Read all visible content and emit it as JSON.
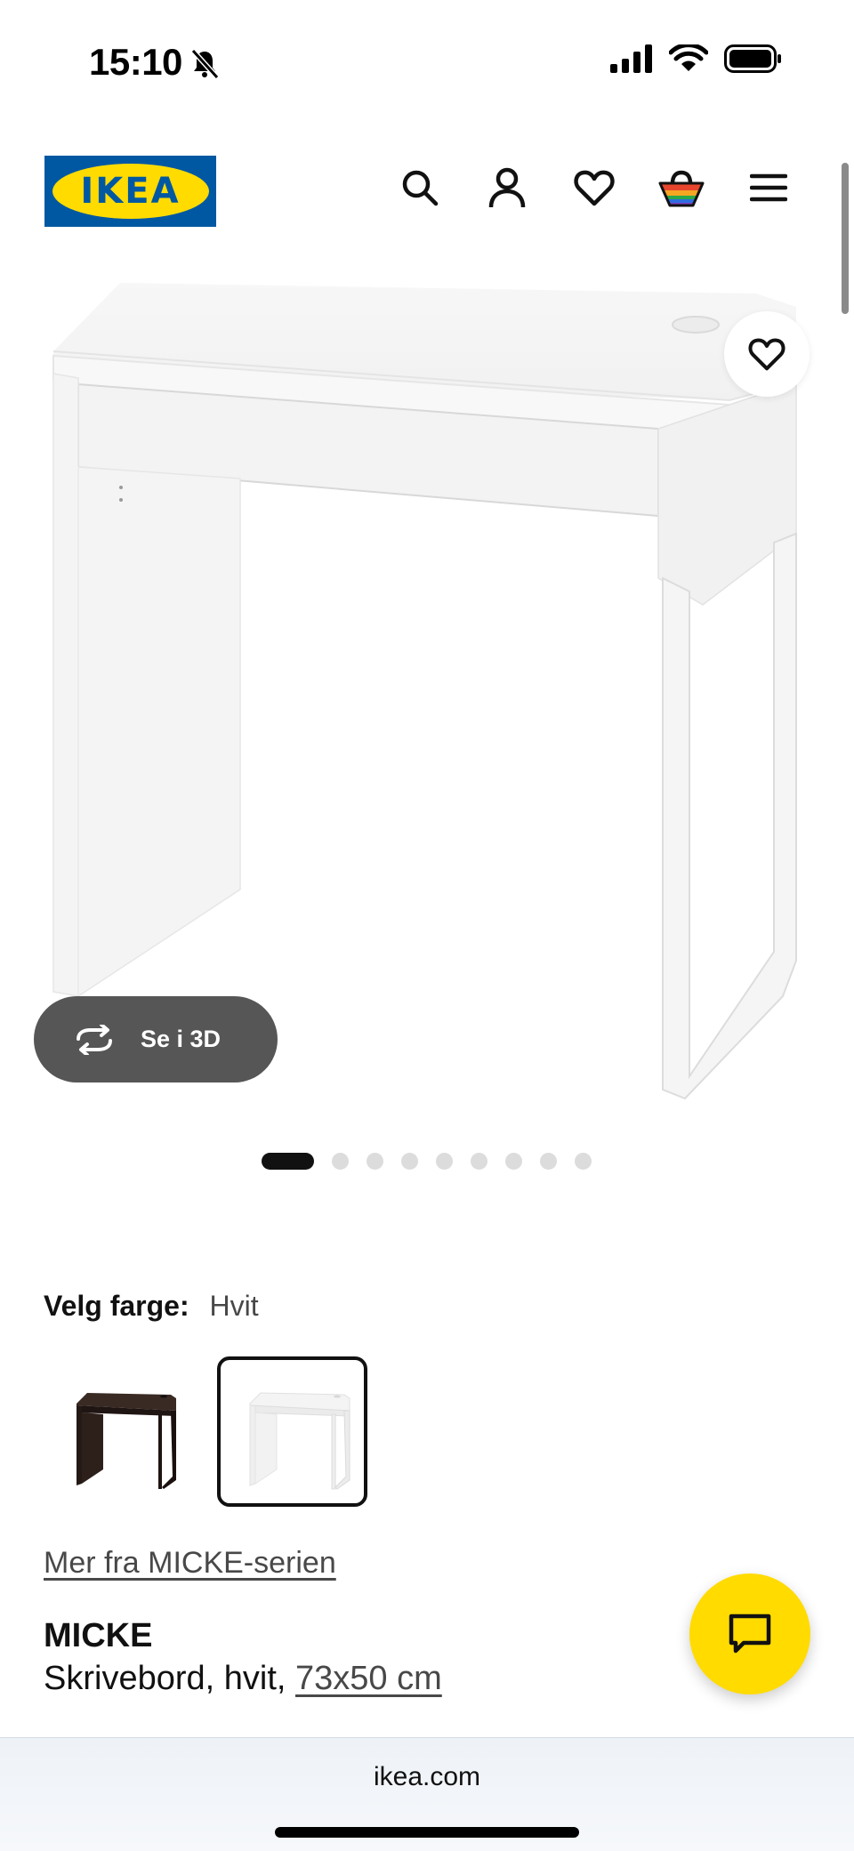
{
  "status": {
    "time": "15:10"
  },
  "header": {
    "logo_text": "IKEA",
    "icons": [
      "search-icon",
      "account-icon",
      "favorites-icon",
      "cart-icon",
      "menu-icon"
    ]
  },
  "product_image": {
    "view_3d_label": "Se i 3D",
    "carousel_total": 9,
    "carousel_active": 1
  },
  "color": {
    "label": "Velg farge:",
    "value": "Hvit",
    "swatches": [
      {
        "name": "black-brown",
        "selected": false
      },
      {
        "name": "white",
        "selected": true
      }
    ]
  },
  "series_link": "Mer fra MICKE-serien",
  "product": {
    "name": "MICKE",
    "description": "Skrivebord, hvit,",
    "size": "73x50 cm"
  },
  "browser": {
    "url": "ikea.com"
  },
  "colors": {
    "ikea_blue": "#0058a3",
    "ikea_yellow": "#ffdb00",
    "button_dark": "#565656"
  }
}
